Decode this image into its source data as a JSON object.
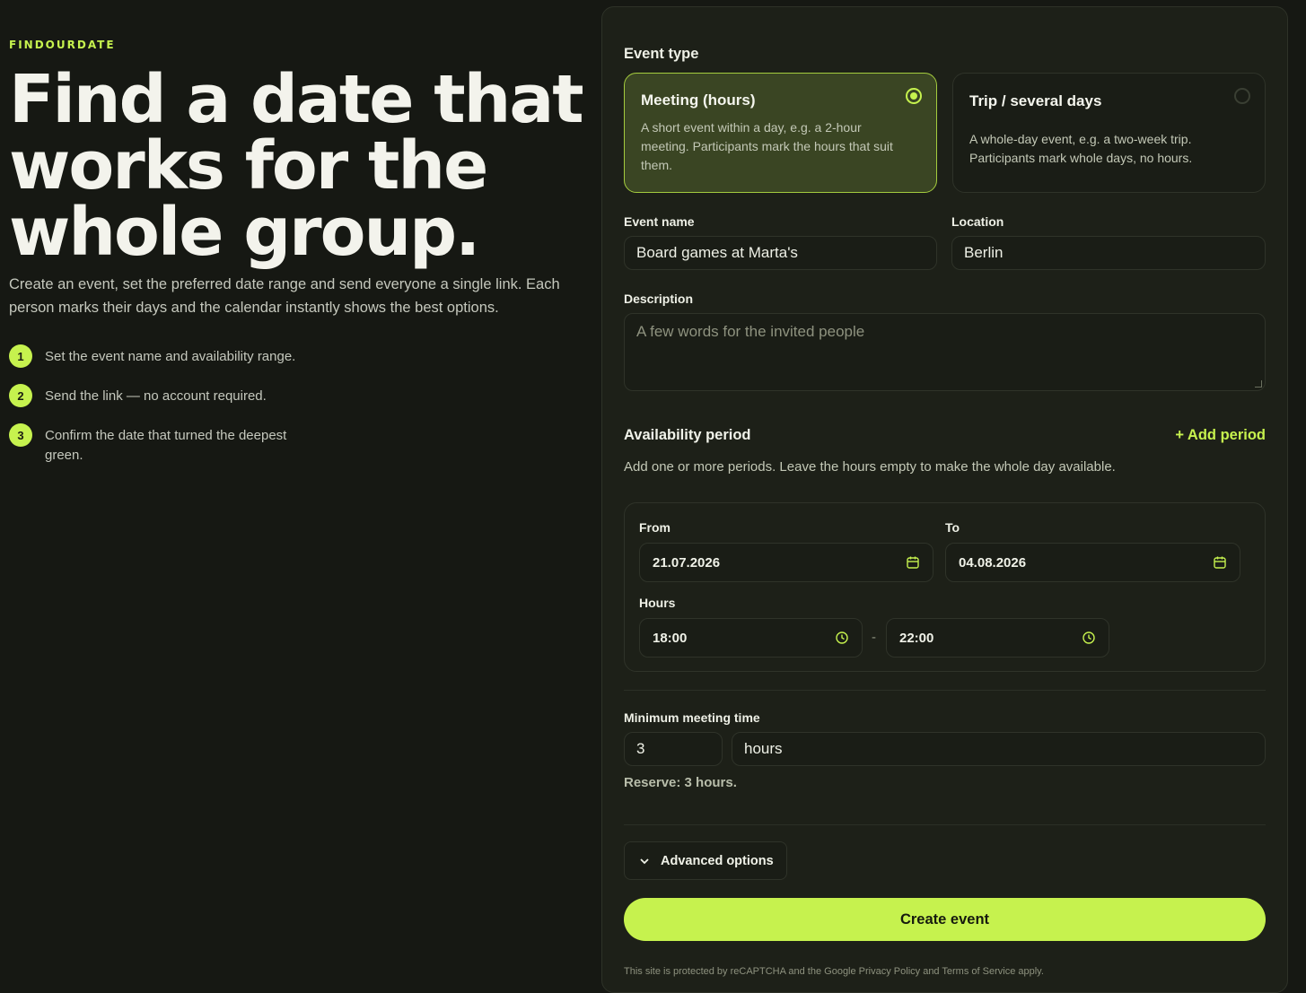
{
  "brand": "FINDOURDATE",
  "hero": {
    "title": "Find a date that works for the whole group.",
    "intro": "Create an event, set the preferred date range and send everyone a single link. Each person marks their days and the calendar instantly shows the best options."
  },
  "steps": [
    {
      "num": "1",
      "text": "Set the event name and availability range."
    },
    {
      "num": "2",
      "text": "Send the link — no account required."
    },
    {
      "num": "3",
      "text": "Confirm the date that turned the deepest green."
    }
  ],
  "form": {
    "event_type_label": "Event type",
    "types": [
      {
        "title": "Meeting (hours)",
        "desc": "A short event within a day, e.g. a 2-hour meeting. Participants mark the hours that suit them.",
        "selected": true
      },
      {
        "title": "Trip / several days",
        "desc": "A whole-day event, e.g. a two-week trip. Participants mark whole days, no hours.",
        "selected": false
      }
    ],
    "event_name_label": "Event name",
    "event_name_value": "Board games at Marta's",
    "location_label": "Location",
    "location_value": "Berlin",
    "description_label": "Description",
    "description_placeholder": "A few words for the invited people",
    "availability_title": "Availability period",
    "add_period": "+ Add period",
    "availability_hint": "Add one or more periods. Leave the hours empty to make the whole day available.",
    "period": {
      "from_label": "From",
      "from_value": "21.07.2026",
      "to_label": "To",
      "to_value": "04.08.2026",
      "hours_label": "Hours",
      "hours_from": "18:00",
      "hours_separator": "-",
      "hours_to": "22:00"
    },
    "min_time_label": "Minimum meeting time",
    "min_time_value": "3",
    "min_time_unit": "hours",
    "reserve_text": "Reserve: 3 hours.",
    "advanced_label": "Advanced options",
    "create_label": "Create event",
    "legal_text": "This site is protected by reCAPTCHA and the Google Privacy Policy and Terms of Service apply."
  },
  "colors": {
    "accent": "#c6f24e",
    "background": "#161813",
    "panel": "#1d2018",
    "selected_card": "#3a4523"
  }
}
